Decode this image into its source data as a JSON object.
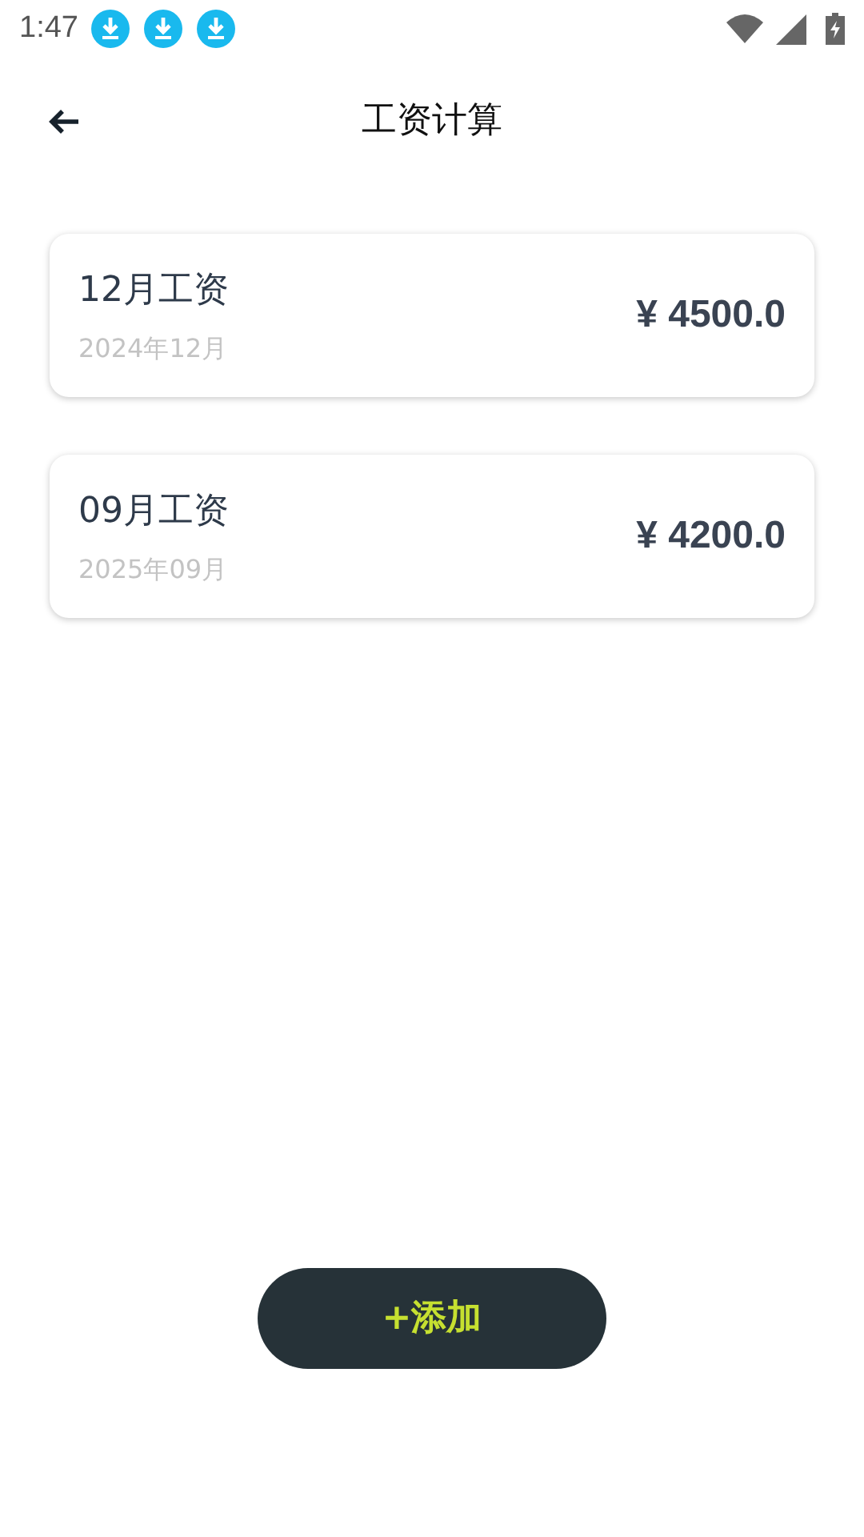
{
  "status_bar": {
    "time": "1:47",
    "notifications": [
      {
        "kind": "download"
      },
      {
        "kind": "download"
      },
      {
        "kind": "download"
      }
    ]
  },
  "header": {
    "title": "工资计算"
  },
  "salaries": [
    {
      "title": "12月工资",
      "date": "2024年12月",
      "amount": "¥ 4500.0"
    },
    {
      "title": "09月工资",
      "date": "2025年09月",
      "amount": "¥ 4200.0"
    }
  ],
  "add_button": {
    "label": "+添加"
  }
}
